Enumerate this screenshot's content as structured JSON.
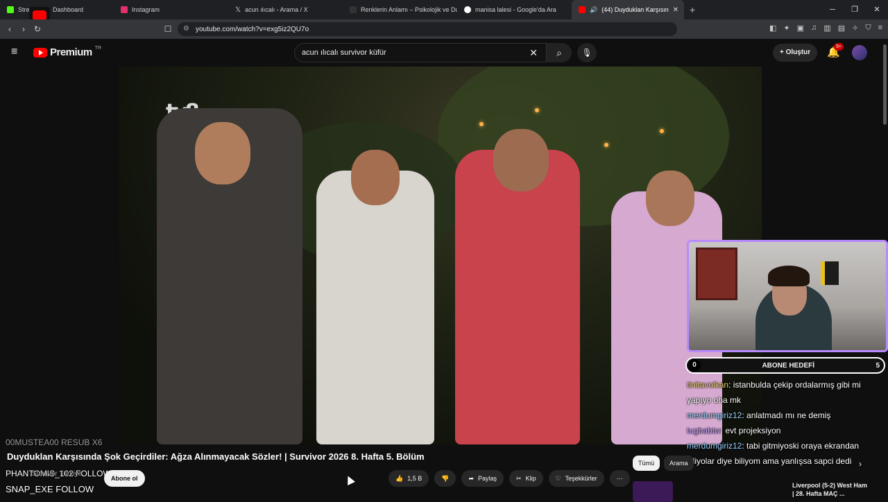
{
  "browser": {
    "tabs": [
      {
        "label": "Stre...",
        "color": "#53fc18"
      },
      {
        "label": "Dashboard",
        "color": "#2b2b2b"
      },
      {
        "label": "Instagram",
        "color": "#e1306c"
      },
      {
        "label": "acun ılıcalı - Arama / X",
        "color": "#ffffff"
      },
      {
        "label": "Renklerin Anlamı – Psikolojik ve Duyg...",
        "color": "#333333"
      },
      {
        "label": "manisa lalesi - Google'da Ara",
        "color": "#4285f4"
      },
      {
        "label": "(44) Duyduklan Karşısında Şo...",
        "color": "#ff0000"
      }
    ],
    "url": "youtube.com/watch?v=exg5iz2QU7o"
  },
  "youtube": {
    "brand": "Premium",
    "region": "TR",
    "search_query": "acun ılıcalı survivor küfür",
    "create_label": "Oluştur",
    "notif_badge": "9+"
  },
  "video": {
    "channel_logo": "tv8",
    "title": "Duyduklan Karşısında Şok Geçirdiler: Ağza Alınmayacak Sözler! | Survivor 2026 8. Hafta 5. Bölüm",
    "channel_name": "Survivor Türkiye",
    "subscribe_label": "Abone ol",
    "likes": "1,5 B",
    "share_label": "Paylaş",
    "clip_label": "Klip",
    "thanks_label": "Teşekkürler"
  },
  "stream_overlay": {
    "goal_label": "ABONE HEDEFİ",
    "goal_current": "0",
    "goal_target": "5",
    "alerts": [
      "00MUSTEA00  RESUB X6",
      "PHANTOMIS_102  FOLLOW",
      "SNAP_EXE  FOLLOW"
    ],
    "chat": [
      {
        "user": "tinitavolkan",
        "text": ": istanbulda çekip ordalarmış gibi mi yapıyo oha mk"
      },
      {
        "user": "merdumgiriz12",
        "text": ": anlatmadı mı ne demiş"
      },
      {
        "user": "tugbabtw",
        "text": ": evt projeksiyon"
      },
      {
        "user": "merdumgiriz12",
        "text": ": tabi gitmiyoski oraya ekrandan izliyolar diye biliyom ama yanlışsa sapci dedi"
      }
    ]
  },
  "sidebar": {
    "chips": [
      "Tümü",
      "Arama"
    ],
    "rec_title": "Liverpool (5-2) West Ham | 28. Hafta MAÇ ..."
  }
}
